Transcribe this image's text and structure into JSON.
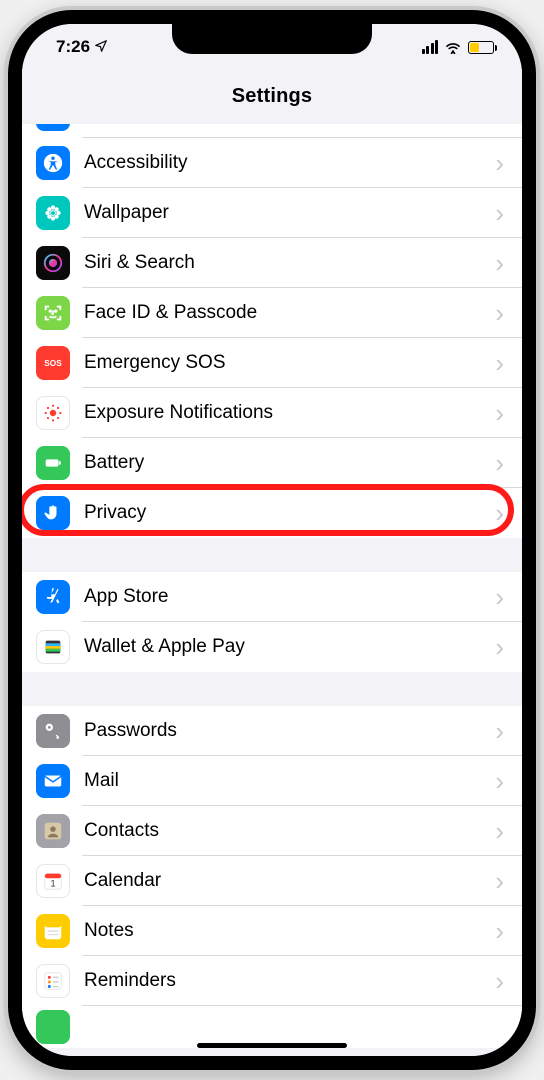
{
  "status": {
    "time": "7:26",
    "location_arrow": "➤"
  },
  "header": {
    "title": "Settings"
  },
  "groups": [
    {
      "rows": [
        {
          "id": "partial-top",
          "label": "",
          "icon": "blue-partial",
          "bg": "bg-blue",
          "partial": true
        },
        {
          "id": "accessibility",
          "label": "Accessibility",
          "icon": "accessibility-icon",
          "bg": "bg-blue"
        },
        {
          "id": "wallpaper",
          "label": "Wallpaper",
          "icon": "flower-icon",
          "bg": "bg-teal"
        },
        {
          "id": "siri",
          "label": "Siri & Search",
          "icon": "siri-icon",
          "bg": "bg-siriblack"
        },
        {
          "id": "faceid",
          "label": "Face ID & Passcode",
          "icon": "face-icon",
          "bg": "bg-lime"
        },
        {
          "id": "sos",
          "label": "Emergency SOS",
          "icon": "sos-icon",
          "bg": "bg-red"
        },
        {
          "id": "exposure",
          "label": "Exposure Notifications",
          "icon": "exposure-icon",
          "bg": "bg-white-b"
        },
        {
          "id": "battery",
          "label": "Battery",
          "icon": "battery-icon",
          "bg": "bg-green"
        },
        {
          "id": "privacy",
          "label": "Privacy",
          "icon": "hand-icon",
          "bg": "bg-blue",
          "highlighted": true
        }
      ]
    },
    {
      "rows": [
        {
          "id": "appstore",
          "label": "App Store",
          "icon": "appstore-icon",
          "bg": "bg-blue"
        },
        {
          "id": "wallet",
          "label": "Wallet & Apple Pay",
          "icon": "wallet-icon",
          "bg": "bg-whitewallet"
        }
      ]
    },
    {
      "rows": [
        {
          "id": "passwords",
          "label": "Passwords",
          "icon": "key-icon",
          "bg": "bg-gray"
        },
        {
          "id": "mail",
          "label": "Mail",
          "icon": "mail-icon",
          "bg": "bg-blue"
        },
        {
          "id": "contacts",
          "label": "Contacts",
          "icon": "contacts-icon",
          "bg": "bg-lgray"
        },
        {
          "id": "calendar",
          "label": "Calendar",
          "icon": "calendar-icon",
          "bg": "bg-whitecal"
        },
        {
          "id": "notes",
          "label": "Notes",
          "icon": "notes-icon",
          "bg": "bg-yellow"
        },
        {
          "id": "reminders",
          "label": "Reminders",
          "icon": "reminders-icon",
          "bg": "bg-whitecal"
        },
        {
          "id": "partial-bottom",
          "label": "",
          "icon": "blank-icon",
          "bg": "bg-green",
          "partial_bottom": true
        }
      ]
    }
  ],
  "highlight": {
    "target": "privacy"
  },
  "sos_text": "SOS"
}
